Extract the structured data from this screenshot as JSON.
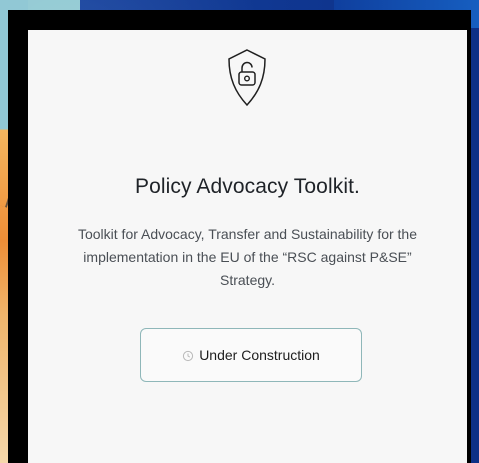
{
  "card": {
    "title": "Policy Advocacy Toolkit.",
    "description": "Toolkit for Advocacy, Transfer and Sustainability for the implementation in the EU of the “RSC against P&SE” Strategy.",
    "status_button": "Under Construction"
  },
  "icons": {
    "shield": "shield-lock-icon",
    "clock": "clock-icon"
  },
  "colors": {
    "card_bg": "#f7f7f7",
    "frame": "#000000",
    "button_border": "#8fb7b9",
    "text_primary": "#1f2328",
    "text_secondary": "#4a4f55"
  }
}
